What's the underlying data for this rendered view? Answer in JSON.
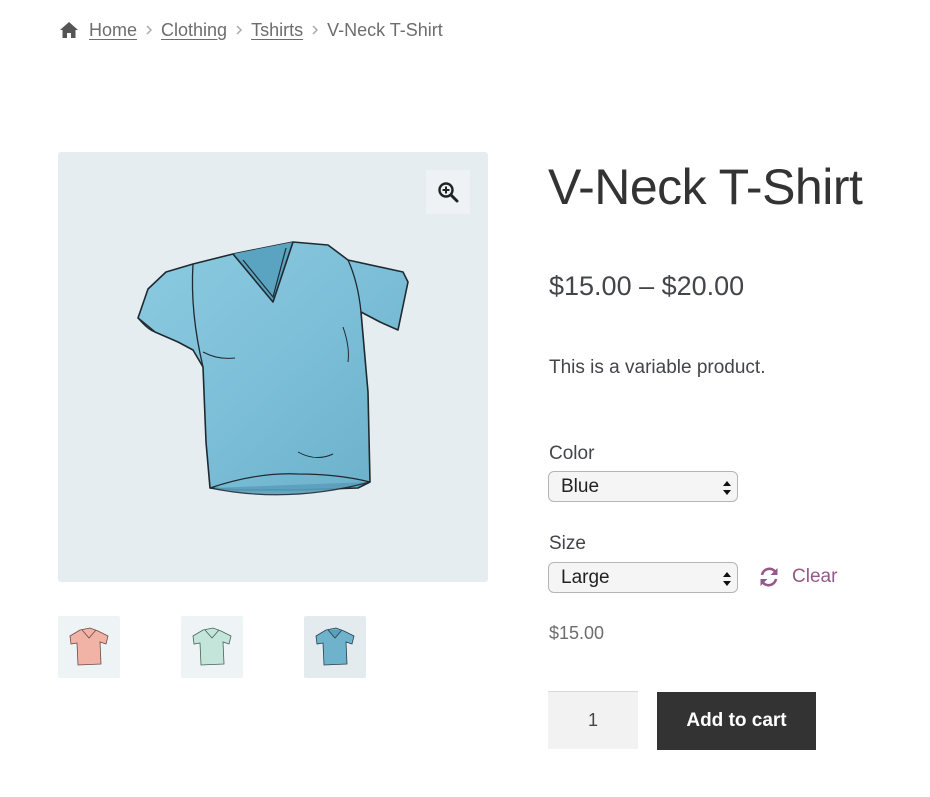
{
  "breadcrumb": {
    "items": [
      {
        "label": "Home"
      },
      {
        "label": "Clothing"
      },
      {
        "label": "Tshirts"
      }
    ],
    "current": "V-Neck T-Shirt"
  },
  "gallery": {
    "main_icon": "tshirt-blue-image",
    "zoom_icon": "magnifier-plus-icon",
    "thumbnails": [
      {
        "icon": "tshirt-pink-thumb",
        "color": "#f2b3a7"
      },
      {
        "icon": "tshirt-mint-thumb",
        "color": "#c4e6da"
      },
      {
        "icon": "tshirt-blue-thumb",
        "color": "#6fb2cc"
      }
    ]
  },
  "product": {
    "title": "V-Neck T-Shirt",
    "price_range": "$15.00 – $20.00",
    "short_description": "This is a variable product.",
    "variations": {
      "color_label": "Color",
      "color_value": "Blue",
      "size_label": "Size",
      "size_value": "Large",
      "clear_label": "Clear"
    },
    "variation_price": "$15.00",
    "quantity": "1",
    "add_to_cart_label": "Add to cart"
  },
  "colors": {
    "accent": "#96588a",
    "button": "#333333",
    "image_bg": "#e6edf1",
    "shirt_blue": "#7dbfd8"
  }
}
